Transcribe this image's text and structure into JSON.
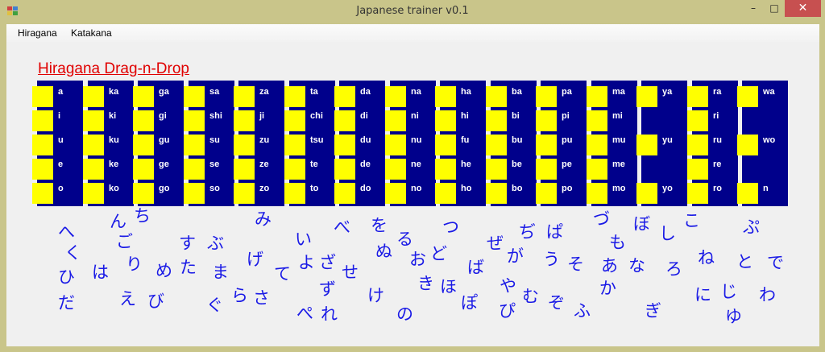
{
  "window": {
    "title": "Japanese trainer v0.1",
    "minimize": "–",
    "maximize": "□",
    "close": "✕",
    "icon": "app-window-icon"
  },
  "menu": [
    "Hiragana",
    "Katakana"
  ],
  "heading": "Hiragana Drag-n-Drop",
  "colors": {
    "tile": "#00008b",
    "slot": "#ffff00",
    "heading": "#e00000",
    "kana": "#1a1ae6"
  },
  "columns": [
    {
      "rows": [
        "a",
        "i",
        "u",
        "e",
        "o"
      ]
    },
    {
      "rows": [
        "ka",
        "ki",
        "ku",
        "ke",
        "ko"
      ]
    },
    {
      "rows": [
        "ga",
        "gi",
        "gu",
        "ge",
        "go"
      ]
    },
    {
      "rows": [
        "sa",
        "shi",
        "su",
        "se",
        "so"
      ]
    },
    {
      "rows": [
        "za",
        "ji",
        "zu",
        "ze",
        "zo"
      ]
    },
    {
      "rows": [
        "ta",
        "chi",
        "tsu",
        "te",
        "to"
      ]
    },
    {
      "rows": [
        "da",
        "di",
        "du",
        "de",
        "do"
      ]
    },
    {
      "rows": [
        "na",
        "ni",
        "nu",
        "ne",
        "no"
      ]
    },
    {
      "rows": [
        "ha",
        "hi",
        "fu",
        "he",
        "ho"
      ]
    },
    {
      "rows": [
        "ba",
        "bi",
        "bu",
        "be",
        "bo"
      ]
    },
    {
      "rows": [
        "pa",
        "pi",
        "pu",
        "pe",
        "po"
      ]
    },
    {
      "rows": [
        "ma",
        "mi",
        "mu",
        "me",
        "mo"
      ]
    },
    {
      "rows": [
        "ya",
        "",
        "yu",
        "",
        "yo"
      ]
    },
    {
      "rows": [
        "ra",
        "ri",
        "ru",
        "re",
        "ro"
      ]
    },
    {
      "rows": [
        "wa",
        "",
        "wo",
        "",
        "n"
      ]
    }
  ],
  "kana": [
    "へ",
    "く",
    "ひ",
    "だ",
    "ん",
    "ご",
    "ち",
    "は",
    "り",
    "え",
    "め",
    "び",
    "た",
    "す",
    "ぶ",
    "ま",
    "ぐ",
    "ら",
    "げ",
    "さ",
    "み",
    "て",
    "い",
    "よ",
    "ざ",
    "ぺ",
    "ず",
    "せ",
    "れ",
    "べ",
    "け",
    "を",
    "ぬ",
    "る",
    "お",
    "ど",
    "の",
    "つ",
    "き",
    "ほ",
    "ぜ",
    "ば",
    "ぽ",
    "ぢ",
    "が",
    "や",
    "ぴ",
    "ぱ",
    "う",
    "む",
    "ぞ",
    "そ",
    "ふ",
    "づ",
    "あ",
    "も",
    "か",
    "ぼ",
    "な",
    "し",
    "ぎ",
    "ろ",
    "こ",
    "ね",
    "に",
    "じ",
    "ゆ",
    "ぷ",
    "と",
    "で",
    "わ"
  ]
}
